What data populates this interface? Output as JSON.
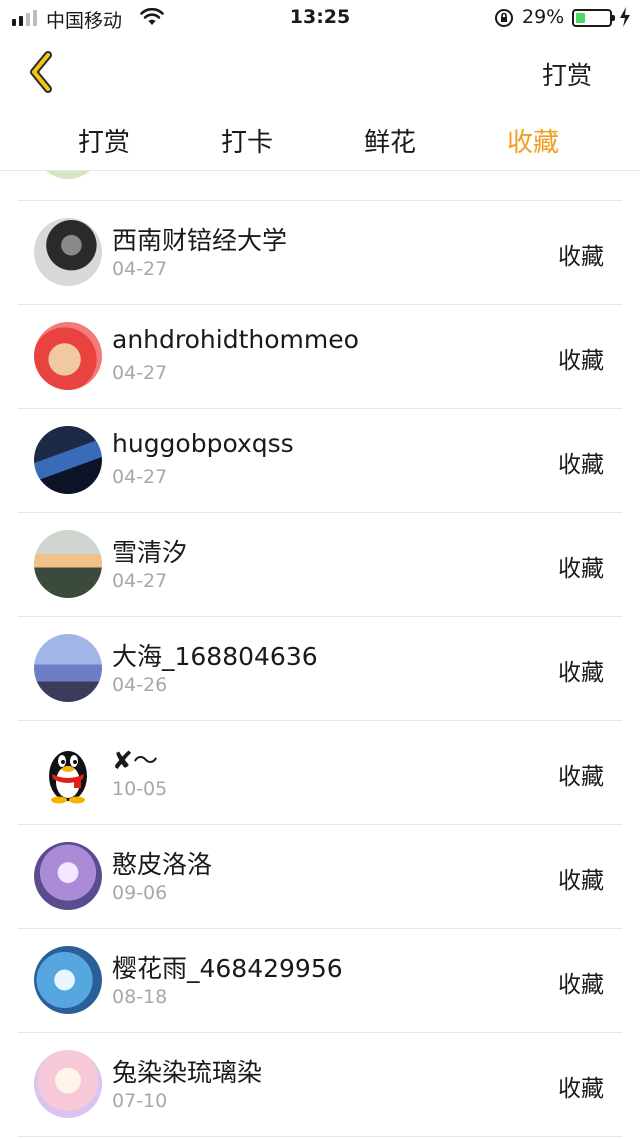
{
  "status_bar": {
    "carrier": "中国移动",
    "time": "13:25",
    "battery_percent": "29%",
    "battery_level": 0.29,
    "signal_bars": 4,
    "signal_bars_filled": 2
  },
  "header": {
    "back_icon": "chevron-left-icon",
    "reward_button": "打赏"
  },
  "tabs": [
    {
      "label": "打赏",
      "active": false
    },
    {
      "label": "打卡",
      "active": false
    },
    {
      "label": "鲜花",
      "active": false
    },
    {
      "label": "收藏",
      "active": true
    }
  ],
  "accent_color": "#f0a020",
  "list": {
    "items": [
      {
        "name": "西南财锫经大学",
        "date": "04-27",
        "action": "收藏"
      },
      {
        "name": "anhdrohidthommeo",
        "date": "04-27",
        "action": "收藏"
      },
      {
        "name": "huggobpoxqss",
        "date": "04-27",
        "action": "收藏"
      },
      {
        "name": "雪清汐",
        "date": "04-27",
        "action": "收藏"
      },
      {
        "name": "大海_168804636",
        "date": "04-26",
        "action": "收藏"
      },
      {
        "name": "✘～",
        "date": "10-05",
        "action": "收藏"
      },
      {
        "name": "憨皮洛洛",
        "date": "09-06",
        "action": "收藏"
      },
      {
        "name": "樱花雨_468429956",
        "date": "08-18",
        "action": "收藏"
      },
      {
        "name": "兔染染琉璃染",
        "date": "07-10",
        "action": "收藏"
      }
    ]
  }
}
